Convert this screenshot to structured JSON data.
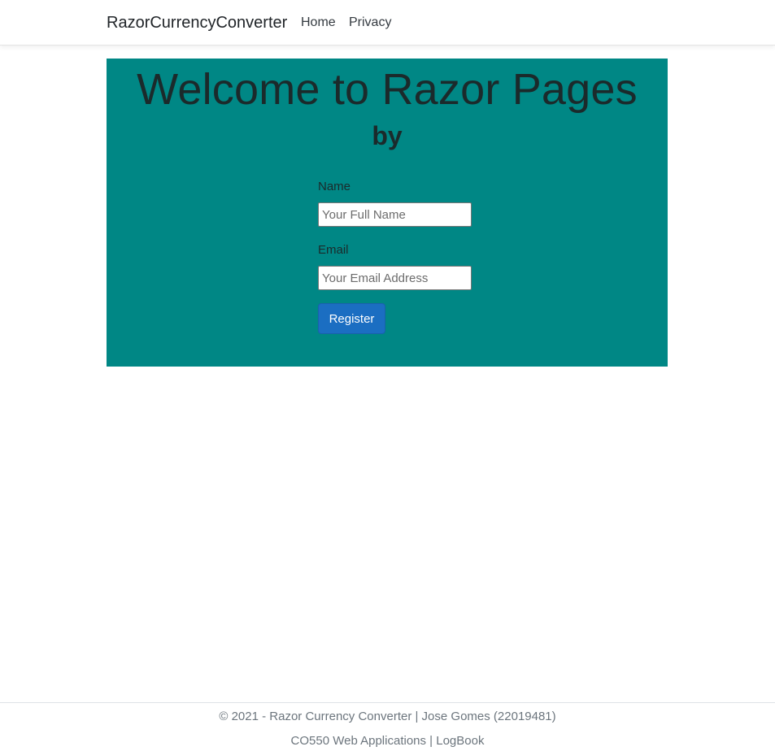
{
  "navbar": {
    "brand": "RazorCurrencyConverter",
    "links": [
      {
        "label": "Home"
      },
      {
        "label": "Privacy"
      }
    ]
  },
  "hero": {
    "title": "Welcome to Razor Pages",
    "subtitle": "by",
    "background_color": "#008785"
  },
  "form": {
    "name_label": "Name",
    "name_placeholder": "Your Full Name",
    "name_value": "",
    "email_label": "Email",
    "email_placeholder": "Your Email Address",
    "email_value": "",
    "submit_label": "Register",
    "submit_color": "#1b6ec2"
  },
  "footer": {
    "line1": "© 2021 - Razor Currency Converter | Jose Gomes (22019481)",
    "course": "CO550 Web Applications",
    "separator": " | ",
    "logbook": "LogBook"
  }
}
